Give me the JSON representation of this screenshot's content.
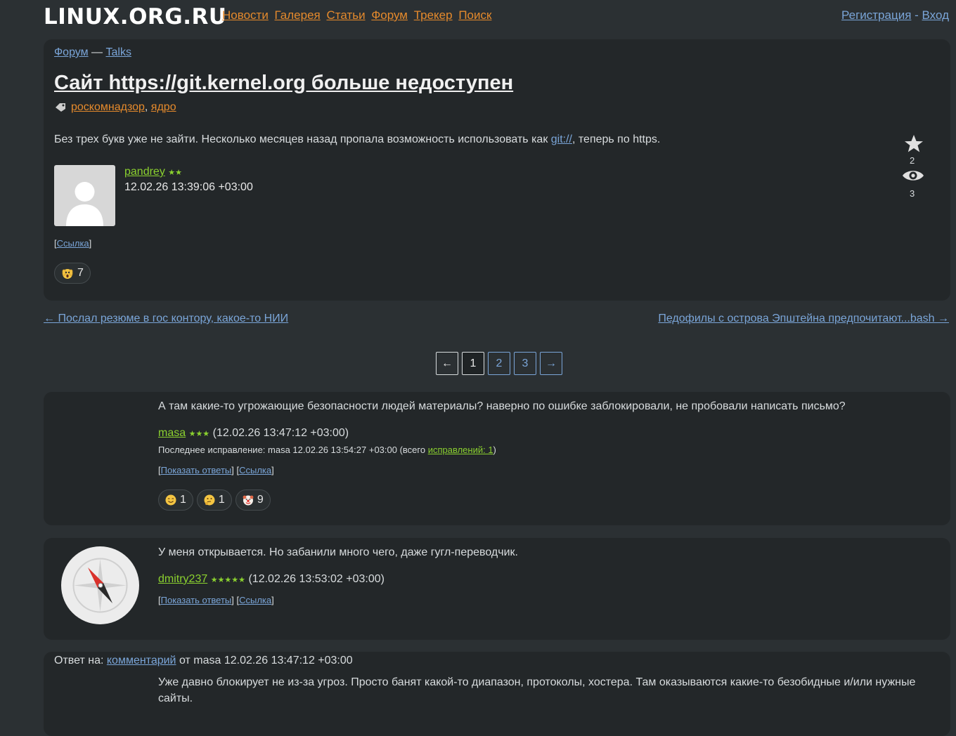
{
  "header": {
    "logo": "LINUX.ORG.RU",
    "nav": [
      "Новости",
      "Галерея",
      "Статьи",
      "Форум",
      "Трекер",
      "Поиск"
    ],
    "register": "Регистрация",
    "sep": " - ",
    "login": "Вход"
  },
  "topic": {
    "crumb_forum": "Форум",
    "crumb_sep": " — ",
    "crumb_section": "Talks",
    "title": "Сайт https://git.kernel.org больше недоступен",
    "tags": [
      "роскомнадзор",
      "ядро"
    ],
    "tags_sep": ", ",
    "body_before": "Без трех букв уже не зайти. Несколько месяцев назад пропала возможность использовать как ",
    "body_link": "git://",
    "body_after": ", теперь по https.",
    "author": "pandrey",
    "author_stars": "★★",
    "timestamp": "12.02.26 13:39:06 +03:00",
    "link_label": "Ссылка",
    "reaction_count": "7",
    "favorites": "2",
    "watchers": "3"
  },
  "nav_links": {
    "prev": "← Послал резюме в гос контору, какое-то НИИ",
    "next": "Педофилы с острова Эпштейна предпочитают...bash →"
  },
  "pager": [
    "←",
    "1",
    "2",
    "3",
    "→"
  ],
  "comments": [
    {
      "text": "А там какие-то угрожающие безопасности людей материалы? наверно по ошибке заблокировали, не пробовали написать письмо?",
      "author": "masa",
      "stars": "★★★",
      "time": "(12.02.26 13:47:12 +03:00)",
      "edit_prefix": "Последнее исправление: masa 12.02.26 13:54:27 +03:00 (всего ",
      "edit_link": "исправлений: 1",
      "edit_suffix": ")",
      "show_replies": "Показать ответы",
      "link": "Ссылка",
      "reactions": [
        "1",
        "1",
        "9"
      ]
    },
    {
      "text": "У меня открывается. Но забанили много чего, даже гугл-переводчик.",
      "author": "dmitry237",
      "stars": "★★★★★",
      "time": "(12.02.26 13:53:02 +03:00)",
      "show_replies": "Показать ответы",
      "link": "Ссылка"
    },
    {
      "reply_prefix": "Ответ на: ",
      "reply_link": "комментарий",
      "reply_suffix": " от masa 12.02.26 13:47:12 +03:00",
      "text": "Уже давно блокирует не из-за угроз. Просто банят какой-то диапазон, протоколы, хостера. Там оказываются какие-то безобидные и/или нужные сайты."
    }
  ]
}
